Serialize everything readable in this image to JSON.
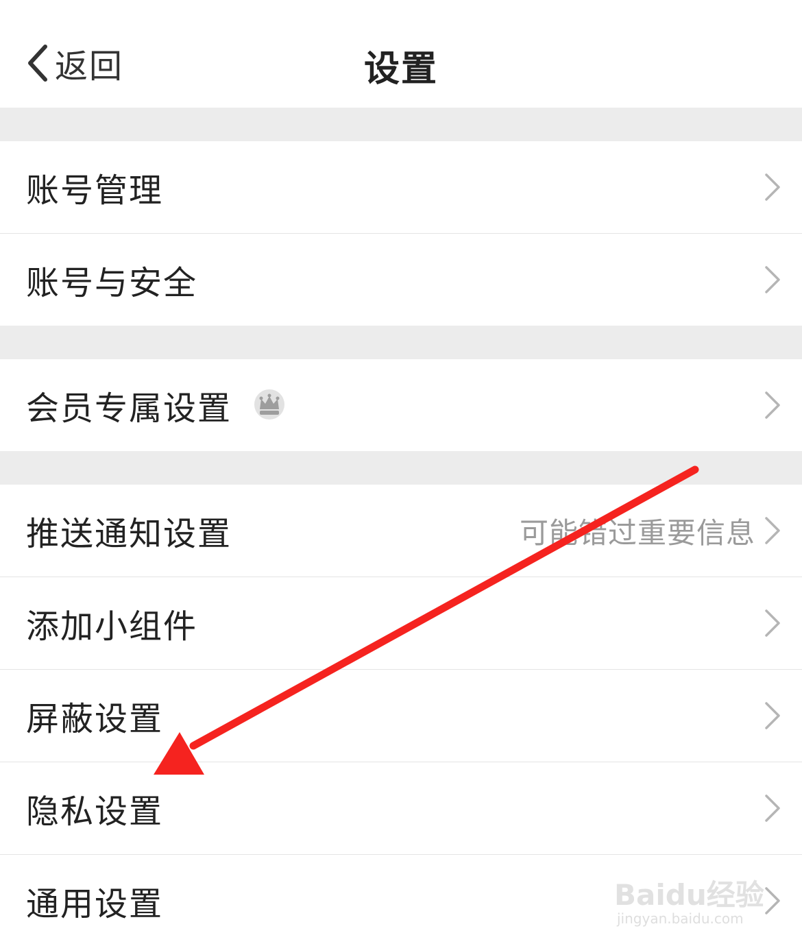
{
  "header": {
    "back_label": "返回",
    "title": "设置"
  },
  "groups": [
    {
      "items": [
        {
          "name": "row-account-management",
          "label": "账号管理"
        },
        {
          "name": "row-account-security",
          "label": "账号与安全"
        }
      ]
    },
    {
      "items": [
        {
          "name": "row-member-settings",
          "label": "会员专属设置",
          "icon": "crown-icon"
        }
      ]
    },
    {
      "items": [
        {
          "name": "row-push-notifications",
          "label": "推送通知设置",
          "value": "可能错过重要信息"
        },
        {
          "name": "row-add-widget",
          "label": "添加小组件"
        },
        {
          "name": "row-block-settings",
          "label": "屏蔽设置"
        },
        {
          "name": "row-privacy-settings",
          "label": "隐私设置"
        },
        {
          "name": "row-general-settings",
          "label": "通用设置"
        }
      ]
    }
  ],
  "watermark": {
    "main": "Baidu经验",
    "sub": "jingyan.baidu.com"
  },
  "colors": {
    "arrow": "#f5231f",
    "section_gap": "#ececec",
    "secondary_text": "#9a9a9a"
  },
  "annotation": {
    "type": "red-arrow-icon",
    "points_to": "隐私设置"
  }
}
